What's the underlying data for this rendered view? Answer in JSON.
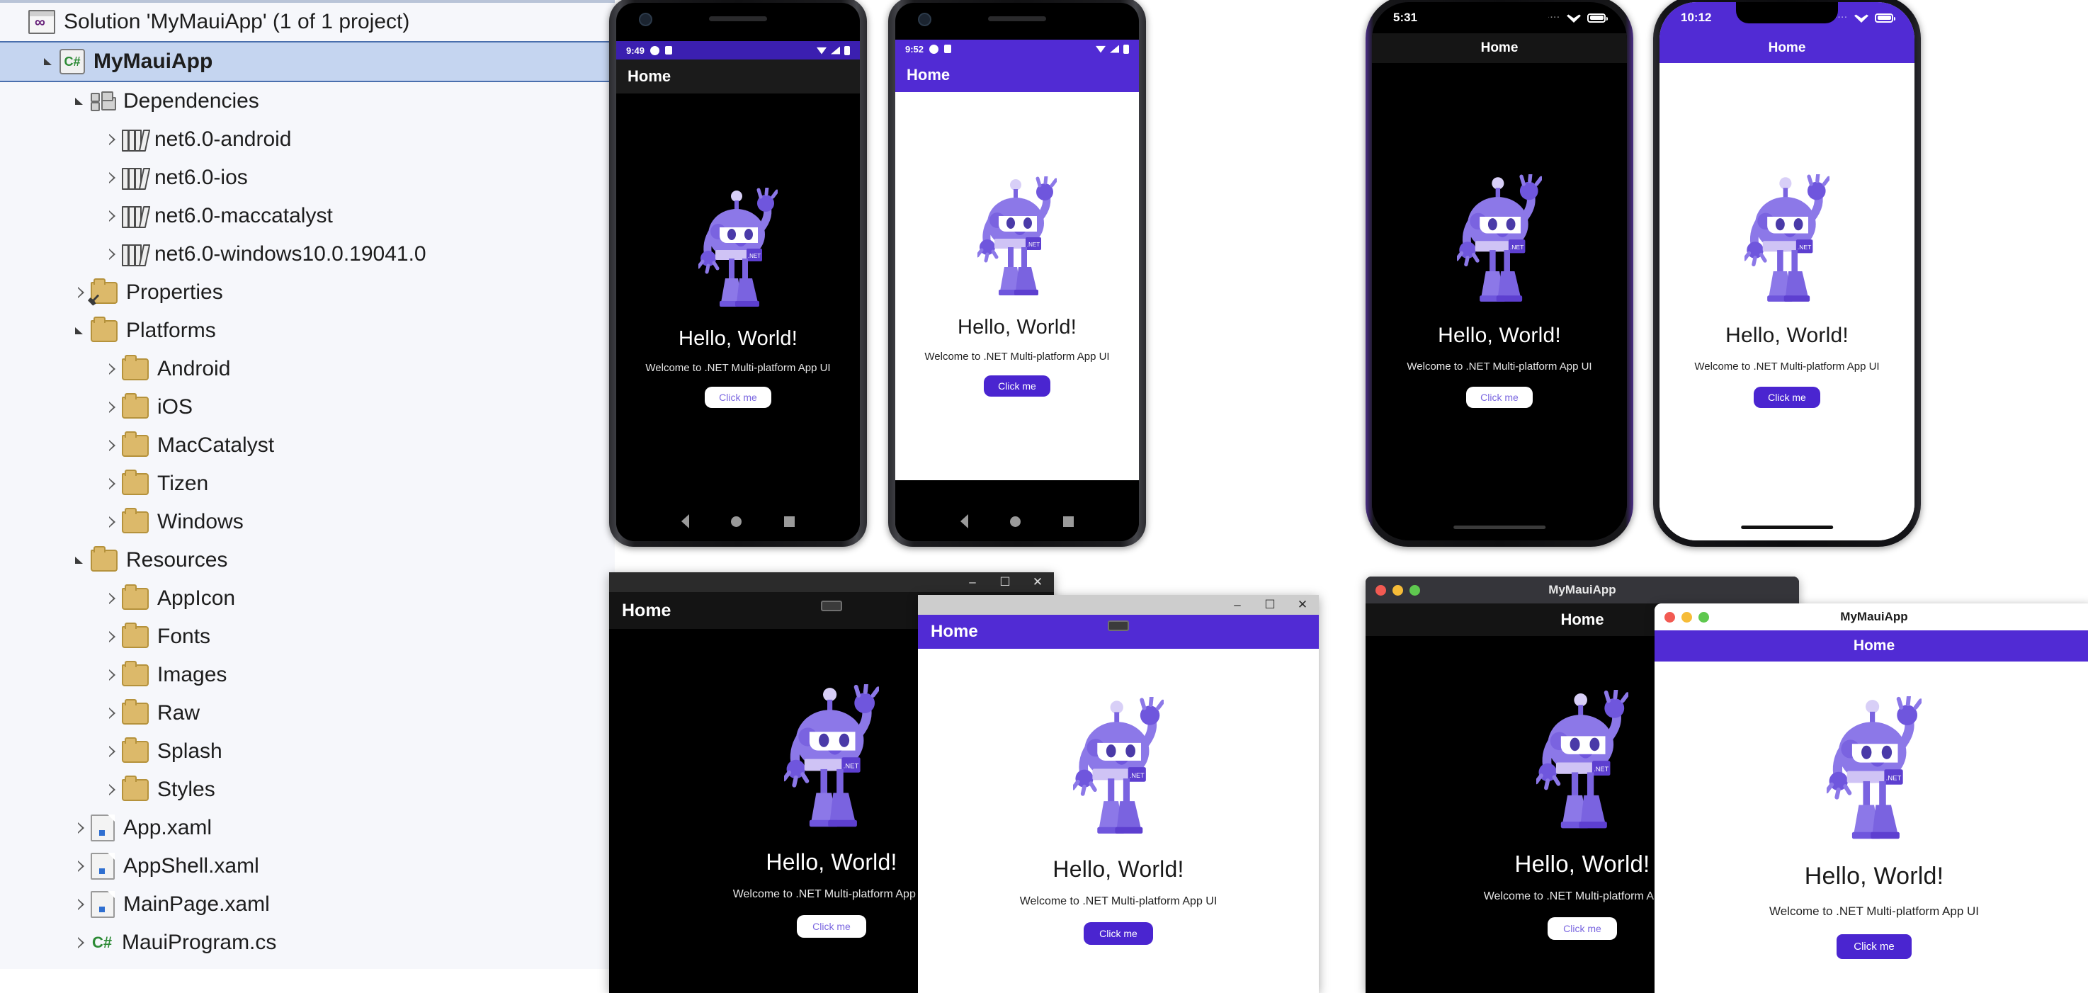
{
  "solution_explorer": {
    "tree": [
      {
        "label": "Solution 'MyMauiApp' (1 of 1 project)",
        "icon": "solution-icon",
        "indent": 0,
        "twisty": "none",
        "selected": false,
        "bold": false
      },
      {
        "label": "MyMauiApp",
        "icon": "csharp-project-icon",
        "indent": 1,
        "twisty": "expanded",
        "selected": true,
        "bold": true
      },
      {
        "label": "Dependencies",
        "icon": "dependencies-icon",
        "indent": 2,
        "twisty": "expanded",
        "selected": false,
        "bold": false
      },
      {
        "label": "net6.0-android",
        "icon": "framework-icon",
        "indent": 3,
        "twisty": "collapsed",
        "selected": false,
        "bold": false
      },
      {
        "label": "net6.0-ios",
        "icon": "framework-icon",
        "indent": 3,
        "twisty": "collapsed",
        "selected": false,
        "bold": false
      },
      {
        "label": "net6.0-maccatalyst",
        "icon": "framework-icon",
        "indent": 3,
        "twisty": "collapsed",
        "selected": false,
        "bold": false
      },
      {
        "label": "net6.0-windows10.0.19041.0",
        "icon": "framework-icon",
        "indent": 3,
        "twisty": "collapsed",
        "selected": false,
        "bold": false
      },
      {
        "label": "Properties",
        "icon": "properties-folder-icon",
        "indent": 2,
        "twisty": "collapsed",
        "selected": false,
        "bold": false
      },
      {
        "label": "Platforms",
        "icon": "folder-icon",
        "indent": 2,
        "twisty": "expanded",
        "selected": false,
        "bold": false
      },
      {
        "label": "Android",
        "icon": "folder-icon",
        "indent": 3,
        "twisty": "collapsed",
        "selected": false,
        "bold": false
      },
      {
        "label": "iOS",
        "icon": "folder-icon",
        "indent": 3,
        "twisty": "collapsed",
        "selected": false,
        "bold": false
      },
      {
        "label": "MacCatalyst",
        "icon": "folder-icon",
        "indent": 3,
        "twisty": "collapsed",
        "selected": false,
        "bold": false
      },
      {
        "label": "Tizen",
        "icon": "folder-icon",
        "indent": 3,
        "twisty": "collapsed",
        "selected": false,
        "bold": false
      },
      {
        "label": "Windows",
        "icon": "folder-icon",
        "indent": 3,
        "twisty": "collapsed",
        "selected": false,
        "bold": false
      },
      {
        "label": "Resources",
        "icon": "folder-icon",
        "indent": 2,
        "twisty": "expanded",
        "selected": false,
        "bold": false
      },
      {
        "label": "AppIcon",
        "icon": "folder-icon",
        "indent": 3,
        "twisty": "collapsed",
        "selected": false,
        "bold": false
      },
      {
        "label": "Fonts",
        "icon": "folder-icon",
        "indent": 3,
        "twisty": "collapsed",
        "selected": false,
        "bold": false
      },
      {
        "label": "Images",
        "icon": "folder-icon",
        "indent": 3,
        "twisty": "collapsed",
        "selected": false,
        "bold": false
      },
      {
        "label": "Raw",
        "icon": "folder-icon",
        "indent": 3,
        "twisty": "collapsed",
        "selected": false,
        "bold": false
      },
      {
        "label": "Splash",
        "icon": "folder-icon",
        "indent": 3,
        "twisty": "collapsed",
        "selected": false,
        "bold": false
      },
      {
        "label": "Styles",
        "icon": "folder-icon",
        "indent": 3,
        "twisty": "collapsed",
        "selected": false,
        "bold": false
      },
      {
        "label": "App.xaml",
        "icon": "xaml-file-icon",
        "indent": 2,
        "twisty": "collapsed",
        "selected": false,
        "bold": false
      },
      {
        "label": "AppShell.xaml",
        "icon": "xaml-file-icon",
        "indent": 2,
        "twisty": "collapsed",
        "selected": false,
        "bold": false
      },
      {
        "label": "MainPage.xaml",
        "icon": "xaml-file-icon",
        "indent": 2,
        "twisty": "collapsed",
        "selected": false,
        "bold": false
      },
      {
        "label": "MauiProgram.cs",
        "icon": "csharp-file-icon",
        "indent": 2,
        "twisty": "collapsed",
        "selected": false,
        "bold": false
      }
    ]
  },
  "app": {
    "heading": "Hello, World!",
    "subtitle": "Welcome to .NET Multi-platform App UI",
    "button_label": "Click me",
    "page_title": "Home",
    "window_title": "MyMauiApp",
    "accent_color": "#512BD4",
    "accent_dark_color": "#3B1FB0",
    "button_text_dark": "#7A66E0"
  },
  "devices": [
    {
      "name": "android-dark",
      "platform": "Android",
      "theme": "dark",
      "status_time": "9:49",
      "nav_title": "Home",
      "status_icons": [
        "dot-icon",
        "bag-icon",
        "wifi-icon",
        "signal-icon",
        "battery-icon"
      ],
      "nav_buttons": [
        "back-icon",
        "home-icon",
        "recents-icon"
      ]
    },
    {
      "name": "android-light",
      "platform": "Android",
      "theme": "light",
      "status_time": "9:52",
      "nav_title": "Home",
      "status_icons": [
        "dot-icon",
        "bag-icon",
        "wifi-icon",
        "signal-icon",
        "battery-icon"
      ],
      "nav_buttons": [
        "back-icon",
        "home-icon",
        "recents-icon"
      ]
    },
    {
      "name": "ios-dark",
      "platform": "iOS",
      "theme": "dark",
      "status_time": "5:31",
      "nav_title": "Home",
      "status_icons": [
        "cellular-dots-icon",
        "wifi-icon",
        "battery-icon"
      ]
    },
    {
      "name": "ios-light",
      "platform": "iOS",
      "theme": "light",
      "status_time": "10:12",
      "nav_title": "Home",
      "status_icons": [
        "cellular-dots-icon",
        "wifi-icon",
        "battery-icon"
      ]
    }
  ],
  "windows": [
    {
      "name": "windows-dark",
      "platform": "Windows",
      "theme": "dark",
      "nav_title": "Home",
      "controls": {
        "minimize": "–",
        "maximize": "☐",
        "close": "✕"
      }
    },
    {
      "name": "windows-light",
      "platform": "Windows",
      "theme": "light",
      "nav_title": "Home",
      "controls": {
        "minimize": "–",
        "maximize": "☐",
        "close": "✕"
      }
    },
    {
      "name": "mac-dark",
      "platform": "macOS",
      "theme": "dark",
      "window_title": "MyMauiApp",
      "nav_title": "Home",
      "traffic_lights": [
        "close-icon",
        "minimize-icon",
        "zoom-icon"
      ]
    },
    {
      "name": "mac-light",
      "platform": "macOS",
      "theme": "light",
      "window_title": "MyMauiApp",
      "nav_title": "Home",
      "traffic_lights": [
        "close-icon",
        "minimize-icon",
        "zoom-icon"
      ]
    }
  ]
}
